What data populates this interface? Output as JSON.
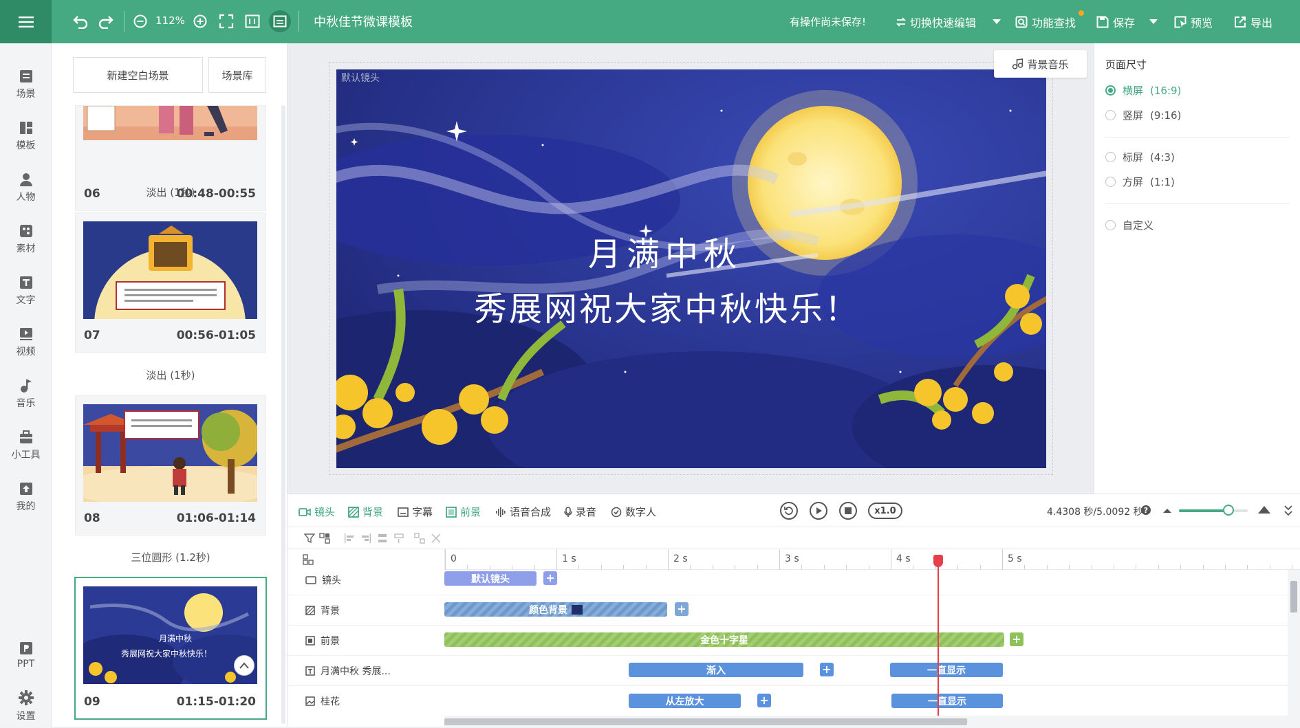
{
  "header": {
    "zoom_text": "112%",
    "doc_title": "中秋佳节微课模板",
    "unsaved_text": "有操作尚未保存!",
    "switch_edit_label": "切换快速编辑",
    "feature_search_label": "功能查找",
    "save_label": "保存",
    "preview_label": "预览",
    "export_label": "导出",
    "accent_color": "#45a982",
    "notify_dot_color": "#f5a623"
  },
  "leftnav": {
    "items": [
      {
        "label": "场景",
        "icon": "scene-icon"
      },
      {
        "label": "模板",
        "icon": "template-icon"
      },
      {
        "label": "人物",
        "icon": "person-icon"
      },
      {
        "label": "素材",
        "icon": "material-icon"
      },
      {
        "label": "文字",
        "icon": "text-icon"
      },
      {
        "label": "视频",
        "icon": "video-icon"
      },
      {
        "label": "音乐",
        "icon": "music-icon"
      },
      {
        "label": "小工具",
        "icon": "toolbox-icon"
      },
      {
        "label": "我的",
        "icon": "upload-icon"
      }
    ],
    "bottom": [
      {
        "label": "PPT",
        "icon": "ppt-icon"
      },
      {
        "label": "设置",
        "icon": "gear-icon"
      }
    ]
  },
  "scene_panel": {
    "new_scene_label": "新建空白场景",
    "library_label": "场景库",
    "scenes": [
      {
        "num": "06",
        "time": "00:48-00:55"
      },
      {
        "num": "07",
        "time": "00:56-01:05"
      },
      {
        "num": "08",
        "time": "01:06-01:14"
      },
      {
        "num": "09",
        "time": "01:15-01:20"
      }
    ],
    "transitions": [
      "淡出 (1秒)",
      "淡出 (1秒)",
      "三位圆形 (1.2秒)"
    ]
  },
  "canvas": {
    "camera_label": "默认镜头",
    "bgm_label": "背景音乐",
    "headline_1": "月满中秋",
    "headline_2": "秀展网祝大家中秋快乐！"
  },
  "props": {
    "title": "页面尺寸",
    "options": [
      {
        "label": "横屏",
        "ratio": "(16:9)",
        "selected": true
      },
      {
        "label": "竖屏",
        "ratio": "(9:16)",
        "selected": false
      },
      {
        "label": "标屏",
        "ratio": "(4:3)",
        "selected": false
      },
      {
        "label": "方屏",
        "ratio": "(1:1)",
        "selected": false
      },
      {
        "label": "自定义",
        "ratio": "",
        "selected": false
      }
    ]
  },
  "timeline": {
    "tabs": [
      {
        "label": "镜头",
        "icon": "camera-icon",
        "green": true
      },
      {
        "label": "背景",
        "icon": "background-icon",
        "green": true
      },
      {
        "label": "字幕",
        "icon": "subtitle-icon",
        "green": false
      },
      {
        "label": "前景",
        "icon": "foreground-icon",
        "green": true
      },
      {
        "label": "语音合成",
        "icon": "waveform-icon",
        "green": false
      },
      {
        "label": "录音",
        "icon": "microphone-icon",
        "green": false
      },
      {
        "label": "数字人",
        "icon": "avatar-icon",
        "green": false
      }
    ],
    "speed": "x1.0",
    "time_readout": "4.4308 秒/5.0092 秒",
    "zoom_level": 0.72,
    "ruler": [
      "0",
      "1 s",
      "2 s",
      "3 s",
      "4 s",
      "5 s"
    ],
    "playhead_seconds": 4.43,
    "tracks": [
      {
        "label": "镜头",
        "icon": "camera-icon"
      },
      {
        "label": "背景",
        "icon": "background-icon"
      },
      {
        "label": "前景",
        "icon": "foreground-icon"
      },
      {
        "label": "月满中秋 秀展...",
        "icon": "text-track-icon"
      },
      {
        "label": "桂花",
        "icon": "image-track-icon"
      }
    ],
    "clips": {
      "camera": "默认镜头",
      "background": "颜色背景",
      "background_swatch": "#1f2d6b",
      "foreground": "金色十字星",
      "text_in": "渐入",
      "text_hold": "一直显示",
      "flower_in": "从左放大",
      "flower_hold": "一直显示"
    }
  }
}
